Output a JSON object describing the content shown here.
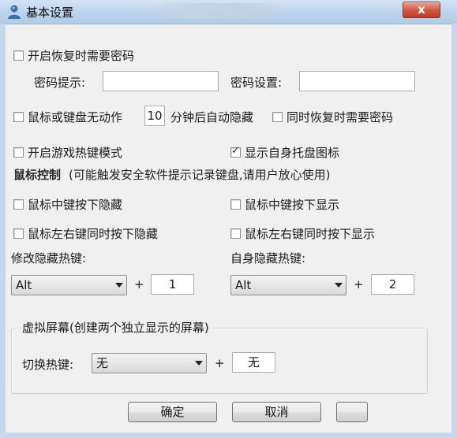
{
  "window": {
    "title": "基本设置",
    "close_label": "x"
  },
  "options": {
    "restore_password": "开启恢复时需要密码",
    "password_hint_label": "密码提示:",
    "password_hint_value": "",
    "password_set_label": "密码设置:",
    "password_set_value": "",
    "idle_hide_prefix": "鼠标或键盘无动作",
    "idle_minutes": "10",
    "idle_hide_suffix": "分钟后自动隐藏",
    "idle_restore_password": "同时恢复时需要密码",
    "game_hotkey_mode": "开启游戏热键模式",
    "show_tray_icon": "显示自身托盘图标"
  },
  "mouse": {
    "heading": "鼠标控制",
    "note": "(可能触发安全软件提示记录键盘,请用户放心使用)",
    "middle_hide": "鼠标中键按下隐藏",
    "middle_show": "鼠标中键按下显示",
    "lr_hide": "鼠标左右键同时按下隐藏",
    "lr_show": "鼠标左右键同时按下显示"
  },
  "hotkeys": {
    "modify_hide_label": "修改隐藏热键:",
    "modify_hide_modifier": "Alt",
    "modify_hide_key": "1",
    "self_hide_label": "自身隐藏热键:",
    "self_hide_modifier": "Alt",
    "self_hide_key": "2",
    "plus": "+"
  },
  "virtual_screen": {
    "group_title": "虚拟屏幕(创建两个独立显示的屏幕)",
    "switch_label": "切换热键:",
    "switch_modifier": "无",
    "switch_key": "无"
  },
  "buttons": {
    "ok": "确定",
    "cancel": "取消",
    "third": ""
  },
  "checked": {
    "restore_password": false,
    "idle_hide": false,
    "idle_restore_password": false,
    "game_hotkey_mode": false,
    "show_tray_icon": true,
    "middle_hide": false,
    "middle_show": false,
    "lr_hide": false,
    "lr_show": false
  }
}
